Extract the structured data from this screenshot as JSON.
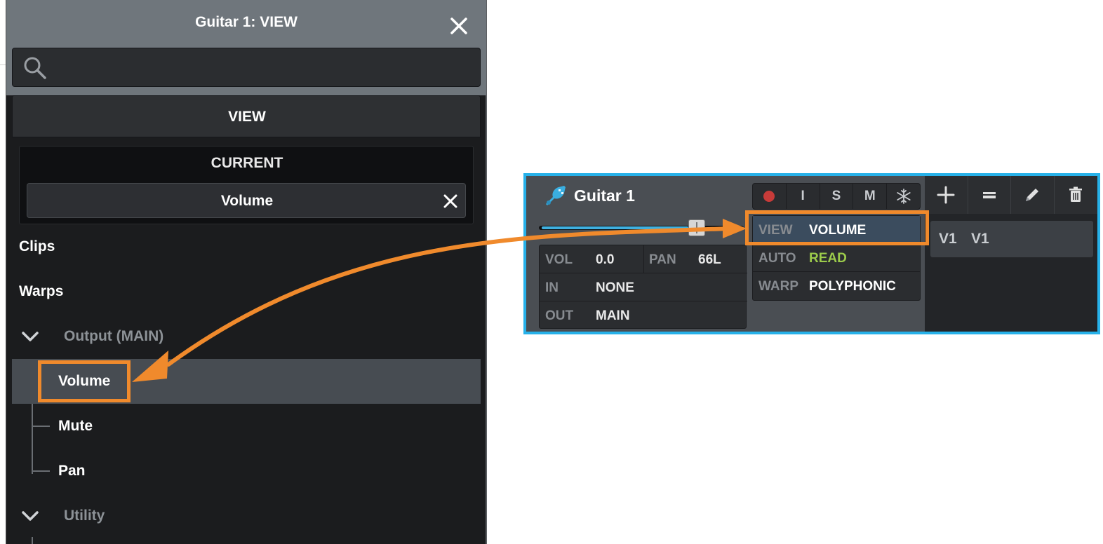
{
  "panel": {
    "title": "Guitar 1: VIEW",
    "search_placeholder": "",
    "view_header": "VIEW",
    "current_label": "CURRENT",
    "current_value": "Volume",
    "items": {
      "clips": "Clips",
      "warps": "Warps",
      "output_group": "Output (MAIN)",
      "volume": "Volume",
      "mute": "Mute",
      "pan": "Pan",
      "utility_group": "Utility"
    }
  },
  "track": {
    "name": "Guitar 1",
    "buttons": {
      "input": "I",
      "solo": "S",
      "mute": "M"
    },
    "fader_level": 0.78,
    "params": {
      "vol_key": "VOL",
      "vol_val": "0.0",
      "pan_key": "PAN",
      "pan_val": "66L",
      "in_key": "IN",
      "in_val": "NONE",
      "out_key": "OUT",
      "out_val": "MAIN"
    },
    "view": {
      "view_key": "VIEW",
      "view_val": "VOLUME",
      "auto_key": "AUTO",
      "auto_val": "READ",
      "warp_key": "WARP",
      "warp_val": "POLYPHONIC"
    },
    "layer": {
      "a": "V1",
      "b": "V1"
    }
  },
  "colors": {
    "accent_border": "#27b1e9",
    "highlight": "#f08a2c",
    "auto_read": "#9ccb4b",
    "record": "#c73b39"
  },
  "icons": [
    "close-icon",
    "search-icon",
    "chevron-down-icon",
    "guitar-icon",
    "record-icon",
    "snowflake-icon",
    "plus-icon",
    "minus-icon",
    "pencil-icon",
    "trash-icon"
  ]
}
